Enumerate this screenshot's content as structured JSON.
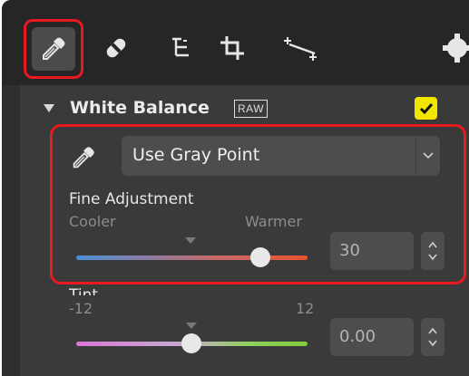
{
  "toolbar": {
    "tools": [
      {
        "icon": "color-picker-icon",
        "selected": true
      },
      {
        "icon": "retouch-brush-icon",
        "selected": false
      },
      {
        "icon": "levels-curves-icon",
        "selected": false
      },
      {
        "icon": "crop-icon",
        "selected": false
      },
      {
        "icon": "straighten-icon",
        "selected": false
      },
      {
        "icon": "settings-gear-icon",
        "selected": false
      }
    ]
  },
  "white_balance": {
    "title": "White Balance",
    "raw_badge": "RAW",
    "enabled": true,
    "mode_icon": "gray-point-picker-icon",
    "mode": "Use Gray Point",
    "fine_adjustment": {
      "label": "Fine Adjustment",
      "min_label": "Cooler",
      "max_label": "Warmer",
      "value": "30"
    },
    "tint": {
      "label": "Tint",
      "min_label": "-12",
      "max_label": "12",
      "value": "0.00"
    }
  },
  "colors": {
    "highlight": "#e8191f",
    "checkbox": "#f2e600",
    "panel_bg": "#2f2f2f"
  }
}
